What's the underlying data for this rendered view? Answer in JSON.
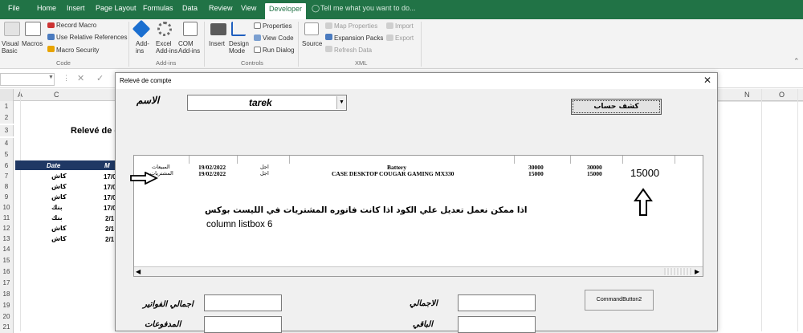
{
  "ribbon_tabs": [
    "File",
    "Home",
    "Insert",
    "Page Layout",
    "Formulas",
    "Data",
    "Review",
    "View",
    "Developer"
  ],
  "tell_me": "Tell me what you want to do...",
  "code_group": {
    "visual_basic": [
      "Visual",
      "Basic"
    ],
    "macros": "Macros",
    "record_macro": "Record Macro",
    "relative_refs": "Use Relative References",
    "macro_security": "Macro Security",
    "label": "Code"
  },
  "addins_group": {
    "addins": [
      "Add-",
      "ins"
    ],
    "excel_addins": [
      "Excel",
      "Add-ins"
    ],
    "com_addins": [
      "COM",
      "Add-ins"
    ],
    "label": "Add-ins"
  },
  "controls_group": {
    "insert": "Insert",
    "design_mode": [
      "Design",
      "Mode"
    ],
    "properties": "Properties",
    "view_code": "View Code",
    "run_dialog": "Run Dialog",
    "label": "Controls"
  },
  "xml_group": {
    "source": "Source",
    "map_properties": "Map Properties",
    "expansion_packs": "Expansion Packs",
    "refresh_data": "Refresh Data",
    "import": "Import",
    "export": "Export",
    "label": "XML"
  },
  "columns": [
    "A",
    "C",
    "N",
    "O"
  ],
  "rows": [
    "1",
    "2",
    "3",
    "4",
    "5",
    "6",
    "7",
    "8",
    "9",
    "10",
    "11",
    "12",
    "13",
    "14",
    "15",
    "16",
    "17",
    "18",
    "19",
    "20",
    "21"
  ],
  "sheet": {
    "title_fragment": "Relevé de c",
    "date_header": "Date",
    "col_header_fragment": "M",
    "rows": [
      {
        "type": "كاش",
        "date": "17/0"
      },
      {
        "type": "كاش",
        "date": "17/0"
      },
      {
        "type": "كاش",
        "date": "17/0"
      },
      {
        "type": "بنك",
        "date": "17/0"
      },
      {
        "type": "بنك",
        "date": "2/1"
      },
      {
        "type": "كاش",
        "date": "2/1"
      },
      {
        "type": "كاش",
        "date": "2/1"
      }
    ]
  },
  "dialog": {
    "title": "Relevé de compte",
    "name_label": "الاسم",
    "name_value": "tarek",
    "statement_button": "كشف حساب",
    "listbox": {
      "rows": [
        {
          "cat": "المبيعات",
          "date": "19/02/2022",
          "kind": "اجل",
          "item": "Battery",
          "qty": "30000",
          "amount": "30000"
        },
        {
          "cat": "المشتريات",
          "date": "19/02/2022",
          "kind": "اجل",
          "item": "CASE DESKTOP COUGAR GAMING MX330",
          "qty": "15000",
          "amount": "15000"
        }
      ],
      "annotation_value": "15000",
      "annotation_text_line1": "اذا ممكن نعمل تعديل علي الكود اذا كانت فاتوره المشتريات في الليست بوكس",
      "annotation_text_line2": "column listbox 6"
    },
    "total_invoices_label": "اجمالي الفواتير",
    "payments_label": "المدفوعات",
    "total_label": "الاجمالي",
    "remaining_label": "الباقي",
    "command_button": "CommandButton2"
  }
}
